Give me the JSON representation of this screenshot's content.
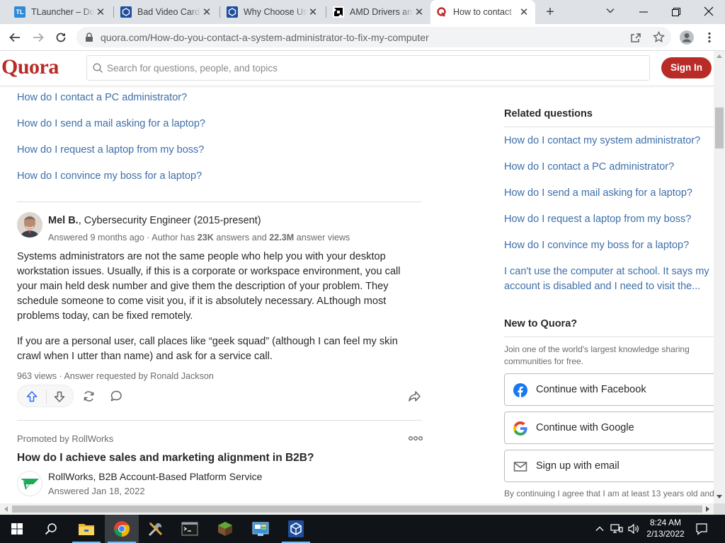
{
  "browser": {
    "tabs": [
      {
        "title": "TLauncher – Do",
        "icon": "tlauncher-favicon",
        "icon_text": "TL",
        "color": "#2f8ad8"
      },
      {
        "title": "Bad Video Card",
        "icon": "blue-square-favicon",
        "color": "#1e4e9c"
      },
      {
        "title": "Why Choose Us",
        "icon": "blue-square-favicon",
        "color": "#1e4e9c"
      },
      {
        "title": "AMD Drivers an",
        "icon": "amd-favicon",
        "color": "#000000"
      },
      {
        "title": "How to contact",
        "icon": "quora-favicon",
        "color": "#b92b27",
        "active": true
      }
    ],
    "url": "quora.com/How-do-you-contact-a-system-administrator-to-fix-my-computer"
  },
  "quora": {
    "logo": "Quora",
    "search_placeholder": "Search for questions, people, and topics",
    "signin_label": "Sign In",
    "brand_color": "#b92b27",
    "link_color": "#3d6fa8"
  },
  "main": {
    "top_links": [
      "How do I contact a PC administrator?",
      "How do I send a mail asking for a laptop?",
      "How do I request a laptop from my boss?",
      "How do I convince my boss for a laptop?"
    ],
    "answer": {
      "author_name": "Mel B.",
      "author_credential": ", Cybersecurity Engineer (2015-present)",
      "meta_prefix": "Answered 9 months ago · Author has ",
      "meta_answers": "23K",
      "meta_mid": " answers and ",
      "meta_views": "22.3M",
      "meta_suffix": " answer views",
      "paragraph1": "Systems administrators are not the same people who help you with your desktop workstation issues. Usually, if this is a corporate or workspace environment, you call your main held desk number and give them the description of your problem. They schedule someone to come visit you, if it is absolutely necessary. ALthough most problems today, can be fixed remotely.",
      "paragraph2": "If you are a personal user, call places like “geek squad” (although I can feel my skin crawl when I utter than name) and ask for a service call.",
      "stats": "963 views · Answer requested by Ronald Jackson"
    },
    "promoted": {
      "label": "Promoted by RollWorks",
      "title": "How do I achieve sales and marketing alignment in B2B?",
      "author_name": "RollWorks",
      "author_credential": ", B2B Account-Based Platform Service",
      "date": "Answered Jan 18, 2022"
    }
  },
  "sidebar": {
    "related_title": "Related questions",
    "related": [
      "How do I contact my system administrator?",
      "How do I contact a PC administrator?",
      "How do I send a mail asking for a laptop?",
      "How do I request a laptop from my boss?",
      "How do I convince my boss for a laptop?",
      "I can't use the computer at school. It says my account is disabled and I need to visit the..."
    ],
    "new_title": "New to Quora?",
    "new_desc": "Join one of the world's largest knowledge sharing communities for free.",
    "facebook_label": "Continue with Facebook",
    "google_label": "Continue with Google",
    "email_label": "Sign up with email",
    "terms": "By continuing I agree that I am at least 13 years old and"
  },
  "taskbar": {
    "time": "8:24 AM",
    "date": "2/13/2022",
    "apps": [
      "file-explorer-icon",
      "chrome-icon",
      "tools-icon",
      "terminal-icon",
      "minecraft-icon",
      "control-panel-icon",
      "blue-cube-icon"
    ]
  }
}
